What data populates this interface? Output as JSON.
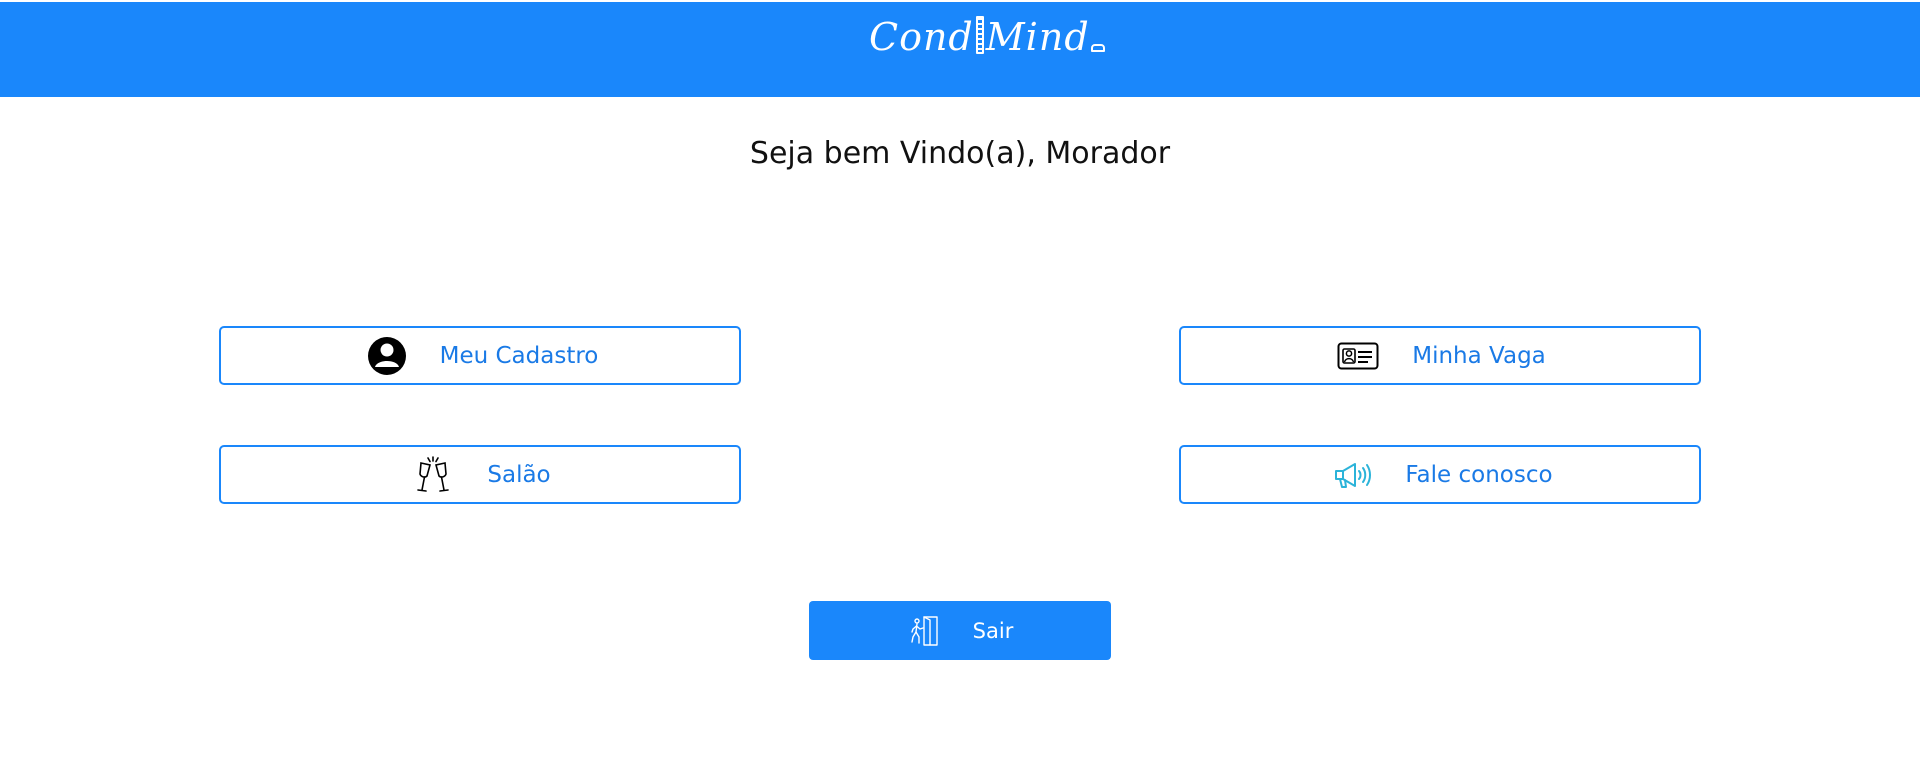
{
  "header": {
    "logo_text_left": "Cond",
    "logo_text_right": "Min",
    "logo_text_tail": "d",
    "background_color": "#1a87fb"
  },
  "welcome": {
    "text": "Seja bem Vindo(a), Morador"
  },
  "menu": {
    "buttons": [
      {
        "label": "Meu Cadastro",
        "icon": "user-avatar-icon"
      },
      {
        "label": "Minha Vaga",
        "icon": "id-card-icon"
      },
      {
        "label": "Salão",
        "icon": "champagne-glasses-icon"
      },
      {
        "label": "Fale conosco",
        "icon": "megaphone-icon"
      }
    ]
  },
  "exit": {
    "label": "Sair",
    "icon": "exit-door-icon"
  },
  "colors": {
    "primary": "#1a87fb",
    "link_text": "#1a7ae6",
    "megaphone": "#2bb3d9"
  }
}
